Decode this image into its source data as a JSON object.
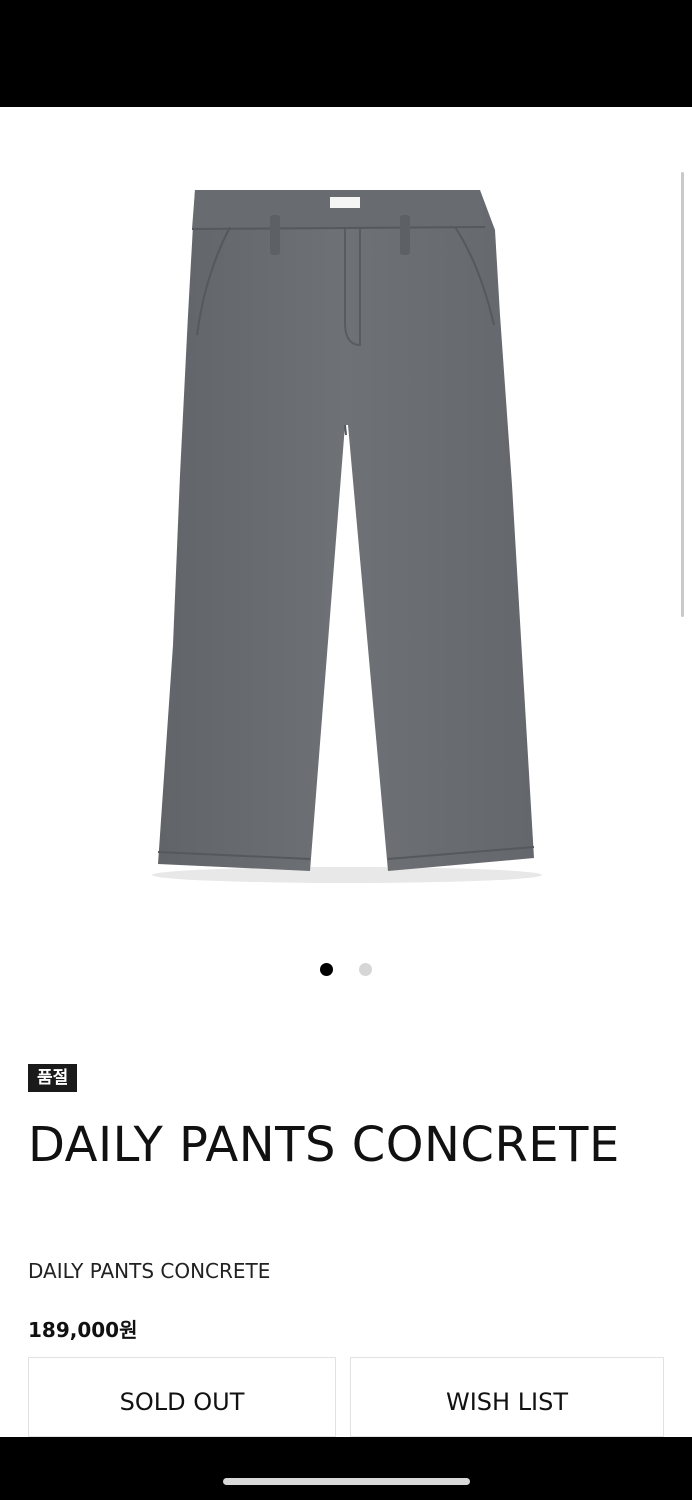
{
  "product": {
    "badge": "품절",
    "title": "DAILY PANTS CONCRETE",
    "subtitle": "DAILY PANTS CONCRETE",
    "price": "189,000원",
    "image_icon": "gray-pants-product-photo",
    "pants_color": "#6b6e72"
  },
  "gallery": {
    "total_images": 2,
    "current_index": 1
  },
  "actions": {
    "sold_out_label": "SOLD OUT",
    "wish_list_label": "WISH LIST"
  }
}
